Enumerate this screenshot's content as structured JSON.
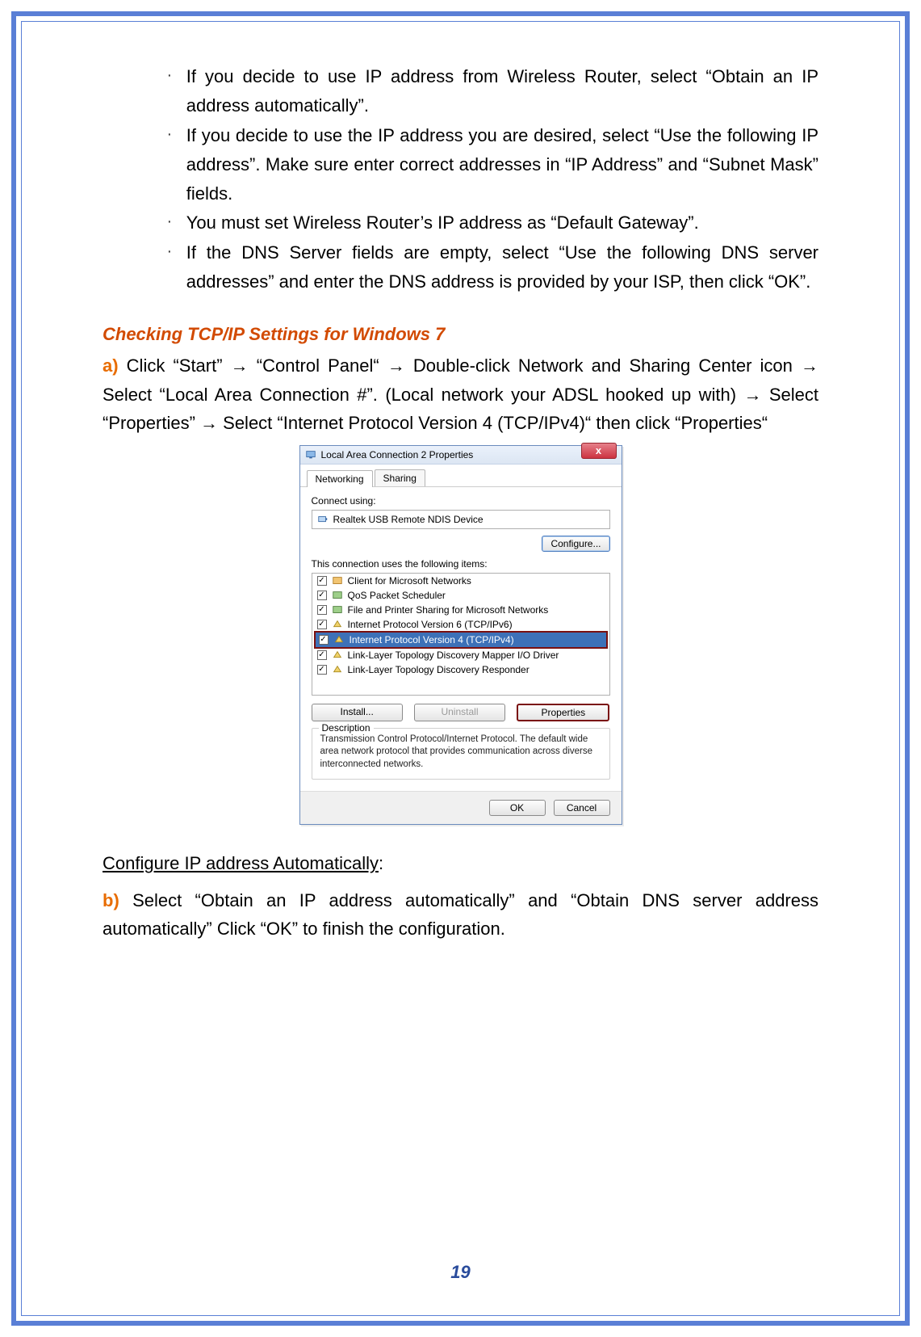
{
  "bullets": [
    "If you decide to use IP address from Wireless Router, select “Obtain an IP address automatically”.",
    "If you decide to use the IP address you are desired, select “Use the following IP address”. Make sure enter correct addresses in “IP Address” and “Subnet Mask” fields.",
    "You must set Wireless Router’s IP address as “Default Gateway”.",
    "If the DNS Server fields are empty, select “Use the following DNS server addresses” and enter the DNS address is provided by your ISP, then click “OK”."
  ],
  "heading": "Checking TCP/IP Settings for Windows 7",
  "step_a": {
    "label": "a)",
    "text": " Click “Start” → “Control Panel“ → Double-click Network and Sharing Center icon → Select “Local Area Connection #”. (Local network your ADSL hooked up with) → Select “Properties” → Select “Internet Protocol Version 4 (TCP/IPv4)“ then click “Properties“"
  },
  "config_auto_label": "Configure IP address Automatically",
  "step_b": {
    "label": "b)",
    "text": " Select “Obtain an IP address automatically” and “Obtain DNS server address automatically” Click “OK” to finish the configuration."
  },
  "dialog": {
    "title": "Local Area Connection 2 Properties",
    "tabs": {
      "networking": "Networking",
      "sharing": "Sharing"
    },
    "connect_using": "Connect using:",
    "adapter": "Realtek USB Remote NDIS Device",
    "configure": "Configure...",
    "items_label": "This connection uses the following items:",
    "items": [
      "Client for Microsoft Networks",
      "QoS Packet Scheduler",
      "File and Printer Sharing for Microsoft Networks",
      "Internet Protocol Version 6 (TCP/IPv6)",
      "Internet Protocol Version 4 (TCP/IPv4)",
      "Link-Layer Topology Discovery Mapper I/O Driver",
      "Link-Layer Topology Discovery Responder"
    ],
    "install": "Install...",
    "uninstall": "Uninstall",
    "properties": "Properties",
    "desc_legend": "Description",
    "desc": "Transmission Control Protocol/Internet Protocol. The default wide area network protocol that provides communication across diverse interconnected networks.",
    "ok": "OK",
    "cancel": "Cancel",
    "close_x": "x"
  },
  "page_number": "19",
  "colon": ":"
}
